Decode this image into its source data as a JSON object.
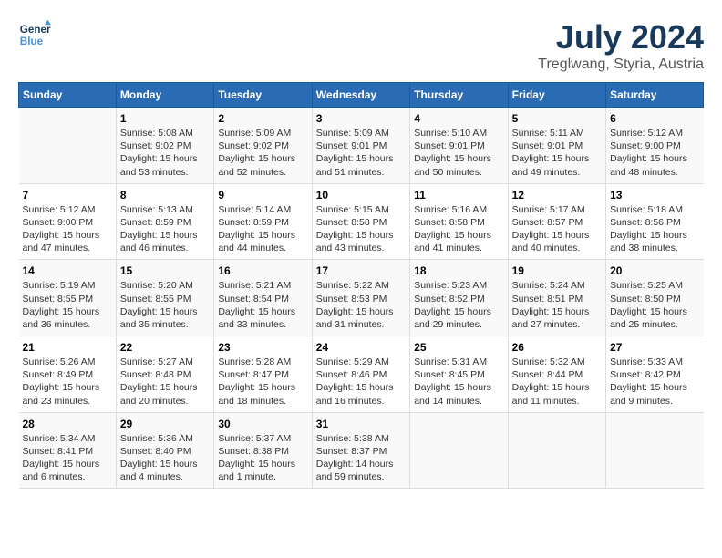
{
  "header": {
    "logo_line1": "General",
    "logo_line2": "Blue",
    "title": "July 2024",
    "subtitle": "Treglwang, Styria, Austria"
  },
  "days_header": [
    "Sunday",
    "Monday",
    "Tuesday",
    "Wednesday",
    "Thursday",
    "Friday",
    "Saturday"
  ],
  "weeks": [
    {
      "cells": [
        {
          "num": "",
          "info": ""
        },
        {
          "num": "1",
          "info": "Sunrise: 5:08 AM\nSunset: 9:02 PM\nDaylight: 15 hours\nand 53 minutes."
        },
        {
          "num": "2",
          "info": "Sunrise: 5:09 AM\nSunset: 9:02 PM\nDaylight: 15 hours\nand 52 minutes."
        },
        {
          "num": "3",
          "info": "Sunrise: 5:09 AM\nSunset: 9:01 PM\nDaylight: 15 hours\nand 51 minutes."
        },
        {
          "num": "4",
          "info": "Sunrise: 5:10 AM\nSunset: 9:01 PM\nDaylight: 15 hours\nand 50 minutes."
        },
        {
          "num": "5",
          "info": "Sunrise: 5:11 AM\nSunset: 9:01 PM\nDaylight: 15 hours\nand 49 minutes."
        },
        {
          "num": "6",
          "info": "Sunrise: 5:12 AM\nSunset: 9:00 PM\nDaylight: 15 hours\nand 48 minutes."
        }
      ]
    },
    {
      "cells": [
        {
          "num": "7",
          "info": "Sunrise: 5:12 AM\nSunset: 9:00 PM\nDaylight: 15 hours\nand 47 minutes."
        },
        {
          "num": "8",
          "info": "Sunrise: 5:13 AM\nSunset: 8:59 PM\nDaylight: 15 hours\nand 46 minutes."
        },
        {
          "num": "9",
          "info": "Sunrise: 5:14 AM\nSunset: 8:59 PM\nDaylight: 15 hours\nand 44 minutes."
        },
        {
          "num": "10",
          "info": "Sunrise: 5:15 AM\nSunset: 8:58 PM\nDaylight: 15 hours\nand 43 minutes."
        },
        {
          "num": "11",
          "info": "Sunrise: 5:16 AM\nSunset: 8:58 PM\nDaylight: 15 hours\nand 41 minutes."
        },
        {
          "num": "12",
          "info": "Sunrise: 5:17 AM\nSunset: 8:57 PM\nDaylight: 15 hours\nand 40 minutes."
        },
        {
          "num": "13",
          "info": "Sunrise: 5:18 AM\nSunset: 8:56 PM\nDaylight: 15 hours\nand 38 minutes."
        }
      ]
    },
    {
      "cells": [
        {
          "num": "14",
          "info": "Sunrise: 5:19 AM\nSunset: 8:55 PM\nDaylight: 15 hours\nand 36 minutes."
        },
        {
          "num": "15",
          "info": "Sunrise: 5:20 AM\nSunset: 8:55 PM\nDaylight: 15 hours\nand 35 minutes."
        },
        {
          "num": "16",
          "info": "Sunrise: 5:21 AM\nSunset: 8:54 PM\nDaylight: 15 hours\nand 33 minutes."
        },
        {
          "num": "17",
          "info": "Sunrise: 5:22 AM\nSunset: 8:53 PM\nDaylight: 15 hours\nand 31 minutes."
        },
        {
          "num": "18",
          "info": "Sunrise: 5:23 AM\nSunset: 8:52 PM\nDaylight: 15 hours\nand 29 minutes."
        },
        {
          "num": "19",
          "info": "Sunrise: 5:24 AM\nSunset: 8:51 PM\nDaylight: 15 hours\nand 27 minutes."
        },
        {
          "num": "20",
          "info": "Sunrise: 5:25 AM\nSunset: 8:50 PM\nDaylight: 15 hours\nand 25 minutes."
        }
      ]
    },
    {
      "cells": [
        {
          "num": "21",
          "info": "Sunrise: 5:26 AM\nSunset: 8:49 PM\nDaylight: 15 hours\nand 23 minutes."
        },
        {
          "num": "22",
          "info": "Sunrise: 5:27 AM\nSunset: 8:48 PM\nDaylight: 15 hours\nand 20 minutes."
        },
        {
          "num": "23",
          "info": "Sunrise: 5:28 AM\nSunset: 8:47 PM\nDaylight: 15 hours\nand 18 minutes."
        },
        {
          "num": "24",
          "info": "Sunrise: 5:29 AM\nSunset: 8:46 PM\nDaylight: 15 hours\nand 16 minutes."
        },
        {
          "num": "25",
          "info": "Sunrise: 5:31 AM\nSunset: 8:45 PM\nDaylight: 15 hours\nand 14 minutes."
        },
        {
          "num": "26",
          "info": "Sunrise: 5:32 AM\nSunset: 8:44 PM\nDaylight: 15 hours\nand 11 minutes."
        },
        {
          "num": "27",
          "info": "Sunrise: 5:33 AM\nSunset: 8:42 PM\nDaylight: 15 hours\nand 9 minutes."
        }
      ]
    },
    {
      "cells": [
        {
          "num": "28",
          "info": "Sunrise: 5:34 AM\nSunset: 8:41 PM\nDaylight: 15 hours\nand 6 minutes."
        },
        {
          "num": "29",
          "info": "Sunrise: 5:36 AM\nSunset: 8:40 PM\nDaylight: 15 hours\nand 4 minutes."
        },
        {
          "num": "30",
          "info": "Sunrise: 5:37 AM\nSunset: 8:38 PM\nDaylight: 15 hours\nand 1 minute."
        },
        {
          "num": "31",
          "info": "Sunrise: 5:38 AM\nSunset: 8:37 PM\nDaylight: 14 hours\nand 59 minutes."
        },
        {
          "num": "",
          "info": ""
        },
        {
          "num": "",
          "info": ""
        },
        {
          "num": "",
          "info": ""
        }
      ]
    }
  ]
}
